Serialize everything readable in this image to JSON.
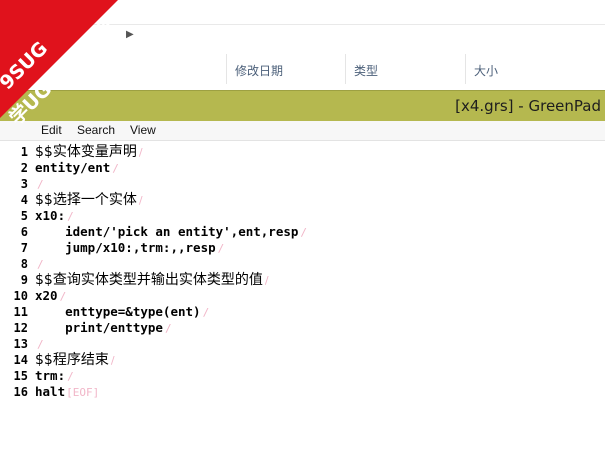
{
  "explorer": {
    "columns": [
      {
        "label": "修改日期"
      },
      {
        "label": "类型"
      },
      {
        "label": "大小"
      }
    ]
  },
  "window": {
    "title": "[x4.grs] - GreenPad",
    "titlebar_color": "#b5b84f"
  },
  "menu": {
    "items": [
      {
        "label": "Edit"
      },
      {
        "label": "Search"
      },
      {
        "label": "View"
      }
    ]
  },
  "editor": {
    "eol_marker": "/",
    "eof_marker": "[EOF]",
    "lines": [
      {
        "num": "1",
        "text": "$$实体变量声明"
      },
      {
        "num": "2",
        "text": "entity/ent"
      },
      {
        "num": "3",
        "text": ""
      },
      {
        "num": "4",
        "text": "$$选择一个实体"
      },
      {
        "num": "5",
        "text": "x10:"
      },
      {
        "num": "6",
        "text": "    ident/'pick an entity',ent,resp"
      },
      {
        "num": "7",
        "text": "    jump/x10:,trm:,,resp"
      },
      {
        "num": "8",
        "text": ""
      },
      {
        "num": "9",
        "text": "$$查询实体类型并输出实体类型的值"
      },
      {
        "num": "10",
        "text": "x20"
      },
      {
        "num": "11",
        "text": "    enttype=&type(ent)"
      },
      {
        "num": "12",
        "text": "    print/enttype"
      },
      {
        "num": "13",
        "text": ""
      },
      {
        "num": "14",
        "text": "$$程序结束"
      },
      {
        "num": "15",
        "text": "trm:"
      },
      {
        "num": "16",
        "text": "halt"
      }
    ]
  },
  "watermark": {
    "line1": "9SUG",
    "line2": "学UG就上UG网",
    "ribbon_color": "#e0121c"
  }
}
